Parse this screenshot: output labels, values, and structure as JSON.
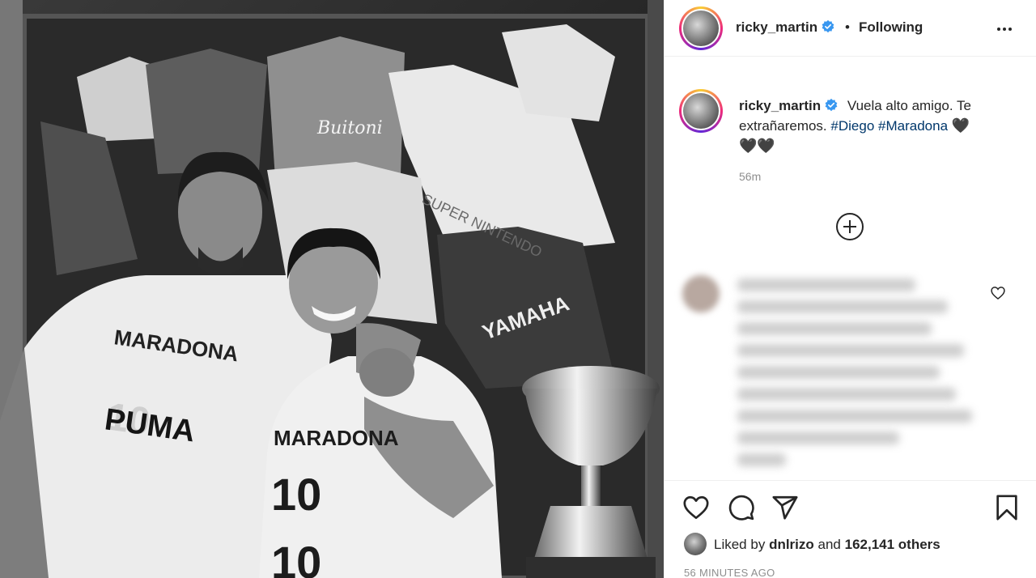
{
  "post": {
    "author": "ricky_martin",
    "follow_state": "Following",
    "separator": "•",
    "photo_text": {
      "shirt_left_top": "MARADONA",
      "shirt_left_brand": "PUMA",
      "shirt_right_top": "MARADONA",
      "jersey_sponsor": "Buitoni",
      "jersey_white_text": "SUPER NINTENDO",
      "jersey_dark_text": "YAMAHA"
    }
  },
  "caption": {
    "username": "ricky_martin",
    "text": "Vuela alto amigo. Te extrañaremos.",
    "hashtag1": "#Diego",
    "hashtag2": "#Maradona",
    "hearts_inline": "🖤",
    "hearts_next": "🖤🖤",
    "time": "56m"
  },
  "engagement": {
    "liked_by_prefix": "Liked by",
    "liked_by_user": "dnlrizo",
    "and": "and",
    "others": "162,141 others",
    "posted": "56 MINUTES AGO"
  },
  "icons": {
    "verified": "verified-badge-icon",
    "more": "more-options-icon",
    "load_more": "load-more-comments-icon",
    "like": "heart-icon",
    "comment": "comment-icon",
    "share": "share-icon",
    "save": "bookmark-icon"
  },
  "colors": {
    "text": "#262626",
    "muted": "#8e8e8e",
    "hashtag": "#00376b",
    "verified": "#3897f0",
    "border": "#efefef"
  }
}
